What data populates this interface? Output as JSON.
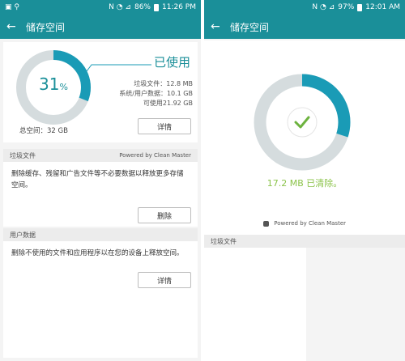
{
  "left": {
    "status": {
      "icons_left": "▣ ⚲",
      "icons_right": "N ◔ ⊿",
      "battery": "86%",
      "time": "11:26 PM"
    },
    "appbar": {
      "title": "储存空间"
    },
    "usage": {
      "percent_number": "31",
      "percent_sign": "%",
      "used_label": "已使用",
      "used_fraction": 0.31,
      "total_label": "总空间：32 GB",
      "lines": [
        "垃圾文件：12.8 MB",
        "系统/用户数据：10.1 GB",
        "可使用21.92 GB"
      ],
      "details_button": "详情"
    },
    "junk": {
      "header": "垃圾文件",
      "powered": "Powered by Clean Master",
      "description": "删除缓存、残留和广告文件等不必要数据以释放更多存储空间。",
      "delete_button": "删除"
    },
    "user_data": {
      "header": "用户数据",
      "description": "删除不使用的文件和应用程序以在您的设备上释放空间。",
      "details_button": "详情"
    },
    "colors": {
      "accent": "#1a8f99",
      "ring_track": "#d5dcde",
      "ring_fill": "#1a9bb6"
    }
  },
  "right": {
    "status": {
      "icons_right": "N ◔ ⊿",
      "battery": "97%",
      "time": "12:01 AM"
    },
    "appbar": {
      "title": "储存空间"
    },
    "result": {
      "cleared_amount": "17.2 MB",
      "cleared_suffix": "已清除。",
      "fill_fraction": 0.3,
      "powered": "Powered by Clean Master",
      "next_header": "垃圾文件"
    },
    "colors": {
      "check": "#6db33f",
      "cleared_text": "#8bc34a"
    }
  }
}
